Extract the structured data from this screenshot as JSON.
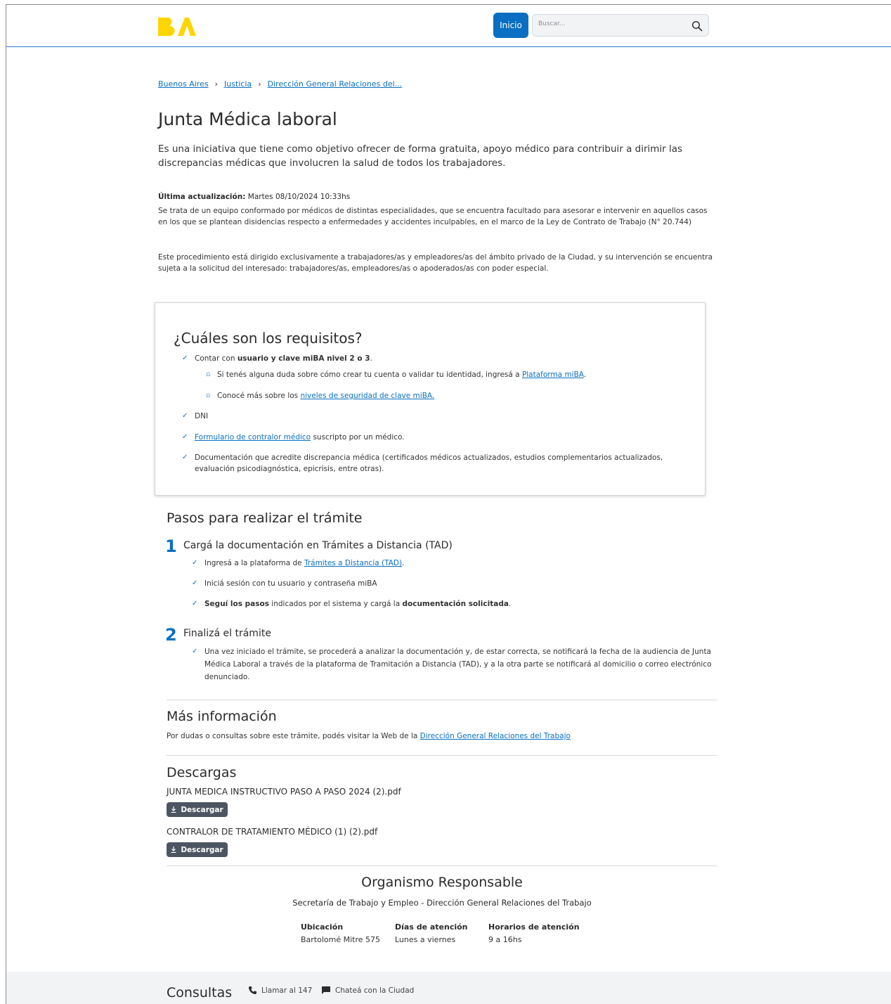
{
  "header": {
    "logo": "BA",
    "home_button": "Inicio",
    "search_placeholder": "Buscar..."
  },
  "breadcrumb": [
    "Buenos Aires",
    "Justicia",
    "Dirección General Relaciones del..."
  ],
  "page": {
    "title": "Junta Médica laboral",
    "intro": "Es una iniciativa que tiene como objetivo ofrecer de forma gratuita, apoyo médico para contribuir a dirimir las discrepancias médicas que involucren la salud de todos los trabajadores.",
    "updated_label": "Última actualización:",
    "updated_value": " Martes 08/10/2024 10:33hs",
    "para1": "Se trata de un equipo conformado por médicos de distintas especialidades, que se encuentra facultado para asesorar e intervenir en aquellos casos en los que se plantean disidencias respecto a enfermedades y accidentes inculpables, en el marco de la Ley de Contrato de Trabajo (N° 20.744)",
    "para2": "Este procedimiento está dirigido exclusivamente a trabajadores/as y empleadores/as del ámbito privado de la Ciudad, y su intervención se encuentra sujeta a la solicitud del interesado: trabajadores/as, empleadores/as o apoderados/as con poder especial."
  },
  "requirements": {
    "title": "¿Cuáles son los requisitos?",
    "item1_pre": "Contar con ",
    "item1_bold": "usuario y clave miBA nivel 2 o 3",
    "item1_post": ".",
    "sub1_pre": "Si tenés alguna duda sobre cómo crear tu cuenta o validar tu identidad, ingresá a ",
    "sub1_link": "Plataforma miBA",
    "sub1_post": ".",
    "sub2_pre": "Conocé más sobre los ",
    "sub2_link": "niveles de seguridad de clave miBA.",
    "item2": "DNI",
    "item3_link": "Formulario de contralor médico",
    "item3_post": " suscripto por un médico.",
    "item4": "Documentación que acredite discrepancia médica (certificados médicos actualizados, estudios complementarios actualizados, evaluación psicodiagnóstica, epicrisis, entre otras)."
  },
  "steps": {
    "title": "Pasos para realizar el trámite",
    "step1_num": "1",
    "step1_title": "Cargá la documentación en Trámites a Distancia (TAD)",
    "s1a_pre": "Ingresá a la plataforma de ",
    "s1a_link": "Trámites a Distancia (TAD)",
    "s1a_post": ".",
    "s1b": "Iniciá sesión con tu usuario y contraseña miBA",
    "s1c_bold1": "Seguí los pasos",
    "s1c_mid": " indicados por el sistema y cargá la ",
    "s1c_bold2": "documentación solicitada",
    "s1c_post": ".",
    "step2_num": "2",
    "step2_title": "Finalizá el trámite",
    "s2a": "Una vez iniciado el trámite, se procederá a analizar la documentación y, de estar correcta, se notificará la fecha de la audiencia de Junta Médica Laboral a través de la plataforma de Tramitación a Distancia (TAD), y a la otra parte se notificará al domicilio o correo electrónico denunciado."
  },
  "more_info": {
    "title": "Más información",
    "text": "Por dudas o consultas sobre este trámite, podés visitar la Web de la ",
    "link": "Dirección General Relaciones del Trabajo"
  },
  "downloads": {
    "title": "Descargas",
    "files": [
      {
        "name": "JUNTA MEDICA INSTRUCTIVO PASO A PASO 2024 (2).pdf",
        "button": "Descargar"
      },
      {
        "name": "CONTRALOR DE TRATAMIENTO MÉDICO (1) (2).pdf",
        "button": "Descargar"
      }
    ]
  },
  "organism": {
    "title": "Organismo Responsable",
    "subtitle": "Secretaría de Trabajo y Empleo - Dirección General Relaciones del Trabajo",
    "location_label": "Ubicación",
    "location_value": "Bartolomé Mitre 575",
    "days_label": "Días de atención",
    "days_value": "Lunes a viernes",
    "hours_label": "Horarios de atención",
    "hours_value": "9 a 16hs"
  },
  "footer": {
    "title": "Consultas",
    "call": "Llamar al 147",
    "chat": "Chateá con la Ciudad"
  },
  "colors": {
    "accent": "#0a6fc2",
    "logo_yellow": "#ffd500",
    "download_button": "#4d5562"
  }
}
